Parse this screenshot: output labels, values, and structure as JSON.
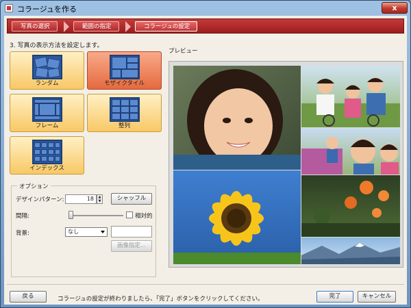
{
  "window": {
    "title": "コラージュを作る",
    "close_label": "x"
  },
  "wizard": {
    "steps": [
      "写真の選択",
      "範囲の指定",
      "コラージュの設定"
    ]
  },
  "section_title": "3. 写真の表示方法を設定します。",
  "preview_label": "プレビュー",
  "layouts": [
    {
      "label": "ランダム",
      "selected": false
    },
    {
      "label": "モザイクタイル",
      "selected": true
    },
    {
      "label": "フレーム",
      "selected": false
    },
    {
      "label": "整列",
      "selected": false
    },
    {
      "label": "インデックス",
      "selected": false
    }
  ],
  "options": {
    "legend": "オプション",
    "design_pattern_label": "デザインパターン:",
    "design_pattern_value": "18",
    "shuffle_label": "シャッフル",
    "spacing_label": "間隔:",
    "relative_label": "相対的",
    "background_label": "背景:",
    "background_value": "なし",
    "image_specify_label": "画像指定..."
  },
  "footer": {
    "back_label": "戻る",
    "message": "コラージュの設定が終わりましたら、「完了」ボタンをクリックしてください。",
    "finish_label": "完了",
    "cancel_label": "キャンセル"
  },
  "colors": {
    "accent_red": "#b22a2a",
    "selected_tile": "#e56a3d",
    "tile": "#f8c866"
  }
}
